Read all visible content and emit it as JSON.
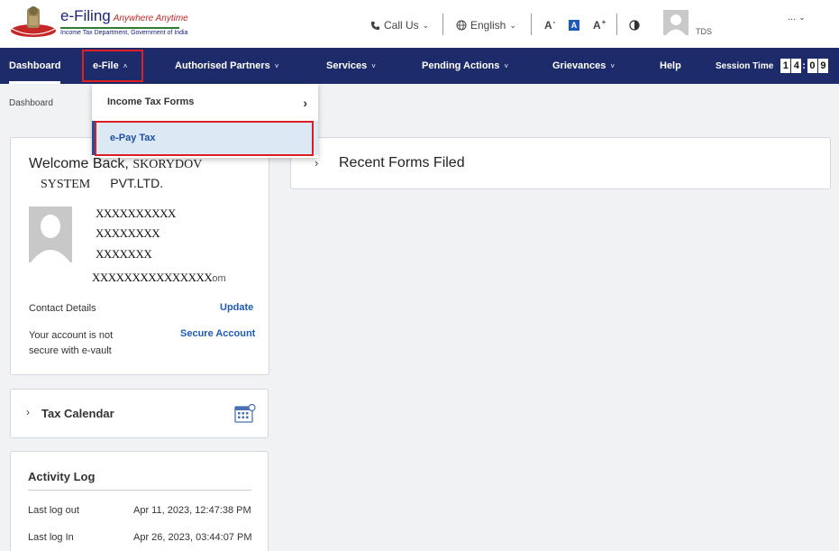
{
  "header": {
    "brand_title": "e-Filing",
    "brand_tagline": "Anywhere Anytime",
    "brand_subtitle": "Income Tax Department, Government of India",
    "call_us": "Call Us",
    "language": "English",
    "font_decrease": "A",
    "font_normal": "A",
    "font_increase": "A",
    "user_role": "TDS",
    "more": "..."
  },
  "nav": {
    "items": [
      {
        "label": "Dashboard"
      },
      {
        "label": "e-File"
      },
      {
        "label": "Authorised Partners"
      },
      {
        "label": "Services"
      },
      {
        "label": "Pending Actions"
      },
      {
        "label": "Grievances"
      },
      {
        "label": "Help"
      }
    ],
    "session_label": "Session Time",
    "session_digits": [
      "1",
      "4",
      "0",
      "9"
    ]
  },
  "breadcrumb": "Dashboard",
  "dropdown": {
    "item1": "Income Tax Forms",
    "item2": "e-Pay Tax"
  },
  "welcome": {
    "greeting": "Welcome Back,",
    "name_masked": "SKORYDOV     ",
    "company_line_1": "SYSTEM",
    "company_line_2": "PVT.LTD.",
    "pan_masked": "XXXXXXXXXX",
    "mobile_masked": "XXXXXXXX",
    "aadhaar_masked": "XXXXXXX",
    "email_masked": "XXXXXXXXXXXXXXX",
    "email_tail": "om",
    "contact_label": "Contact Details",
    "update_link": "Update",
    "vault_text": "Your account is not secure with e-vault",
    "secure_link": "Secure Account"
  },
  "tax_calendar": {
    "title": "Tax Calendar"
  },
  "activity_log": {
    "title": "Activity Log",
    "rows": [
      {
        "label": "Last log out",
        "value": "Apr 11, 2023, 12:47:38 PM"
      },
      {
        "label": "Last log In",
        "value": "Apr 26, 2023, 03:44:07 PM"
      }
    ]
  },
  "recent_forms": {
    "title": "Recent Forms Filed"
  },
  "colors": {
    "nav_bg": "#1d2b6b",
    "link": "#1e5bb8",
    "highlight_border": "#d91e26",
    "dropdown_selected_bg": "#dde8f5"
  },
  "icons": [
    "emblem-icon",
    "phone-icon",
    "globe-icon",
    "contrast-icon",
    "user-avatar-icon",
    "calendar-icon"
  ]
}
